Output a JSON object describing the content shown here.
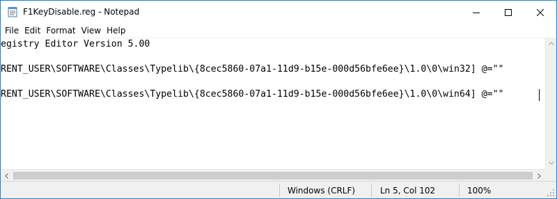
{
  "window": {
    "title": "F1KeyDisable.reg - Notepad",
    "icon": "notepad-icon",
    "border_color": "#1883d7"
  },
  "menu": {
    "items": [
      "File",
      "Edit",
      "Format",
      "View",
      "Help"
    ]
  },
  "editor": {
    "lines": [
      "egistry Editor Version 5.00",
      "RENT_USER\\SOFTWARE\\Classes\\Typelib\\{8cec5860-07a1-11d9-b15e-000d56bfe6ee}\\1.0\\0\\win32] @=\"\"",
      "RENT_USER\\SOFTWARE\\Classes\\Typelib\\{8cec5860-07a1-11d9-b15e-000d56bfe6ee}\\1.0\\0\\win64] @=\"\""
    ]
  },
  "status": {
    "encoding": "Windows (CRLF)",
    "position": "Ln 5, Col 102",
    "zoom": "100%"
  }
}
